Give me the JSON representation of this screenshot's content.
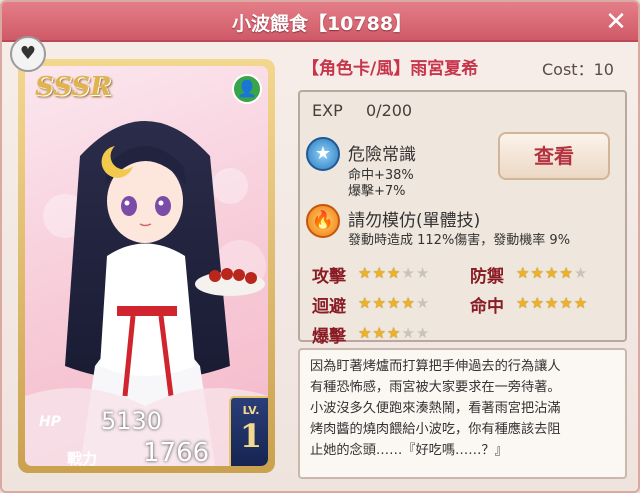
{
  "window": {
    "title": "小波餵食【10788】",
    "close_icon": "close-icon"
  },
  "card": {
    "rarity": "SSSR",
    "hp_label": "HP",
    "hp": "5130",
    "power_label": "戰力",
    "power": "1766",
    "level_label": "LV.",
    "level": "1",
    "border_color": "#d7b466"
  },
  "info": {
    "card_name": "【角色卡/風】雨宮夏希",
    "cost": "Cost：10",
    "exp_label": "EXP",
    "exp": "0/200",
    "view_button": "查看"
  },
  "skills": [
    {
      "name": "危險常識",
      "line1": "命中+38%",
      "line2": "爆擊+7%",
      "icon": "star-badge-icon"
    },
    {
      "name": "請勿模仿(單體技)",
      "line1": "發動時造成 112%傷害，發動機率 9%",
      "icon": "flame-icon"
    }
  ],
  "stats": [
    {
      "label": "攻擊",
      "stars": 3,
      "max": 5
    },
    {
      "label": "防禦",
      "stars": 4,
      "max": 5
    },
    {
      "label": "迴避",
      "stars": 4,
      "max": 5
    },
    {
      "label": "命中",
      "stars": 5,
      "max": 5
    },
    {
      "label": "爆擊",
      "stars": 3,
      "max": 5
    }
  ],
  "description": [
    "因為盯著烤爐而打算把手伸過去的行為讓人",
    "有種恐怖感，雨宮被大家要求在一旁待著。",
    "小波沒多久便跑來湊熱鬧，看著雨宮把沾滿",
    "烤肉醬的燒肉餵給小波吃，你有種應該去阻",
    "止她的念頭……『好吃嗎……？』"
  ]
}
